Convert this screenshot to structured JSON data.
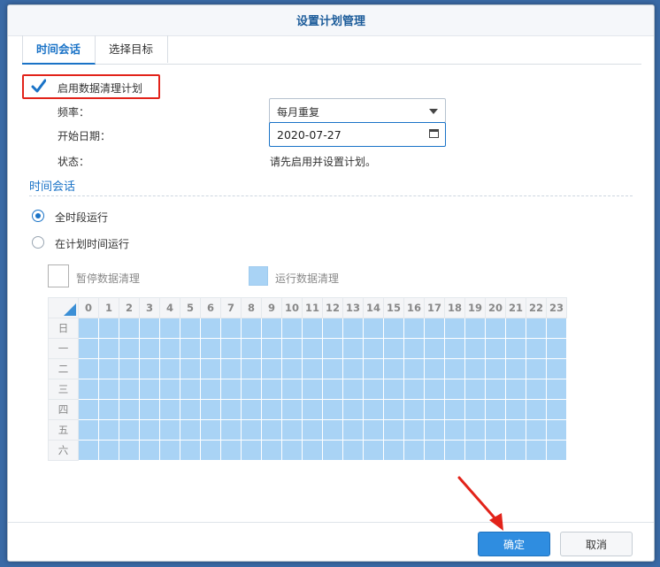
{
  "dialog": {
    "title": "设置计划管理",
    "tabs": [
      "时间会话",
      "选择目标"
    ]
  },
  "enable": {
    "label": "启用数据清理计划",
    "checked": true
  },
  "fields": {
    "frequency_label": "频率：",
    "frequency_value": "每月重复",
    "start_date_label": "开始日期：",
    "start_date_value": "2020-07-27",
    "status_label": "状态：",
    "status_value": "请先启用并设置计划。"
  },
  "session": {
    "title": "时间会话",
    "radio_all": "全时段运行",
    "radio_schedule": "在计划时间运行",
    "selected": "全时段运行"
  },
  "legend": {
    "pause": "暂停数据清理",
    "run": "运行数据清理"
  },
  "schedule": {
    "hours": [
      "0",
      "1",
      "2",
      "3",
      "4",
      "5",
      "6",
      "7",
      "8",
      "9",
      "10",
      "11",
      "12",
      "13",
      "14",
      "15",
      "16",
      "17",
      "18",
      "19",
      "20",
      "21",
      "22",
      "23"
    ],
    "days": [
      "日",
      "一",
      "二",
      "三",
      "四",
      "五",
      "六"
    ]
  },
  "buttons": {
    "ok": "确定",
    "cancel": "取消"
  },
  "colors": {
    "accent": "#1a73c7",
    "run_cell": "#a9d3f5",
    "highlight_box": "#e2231a",
    "ok_button": "#2f8de0"
  }
}
